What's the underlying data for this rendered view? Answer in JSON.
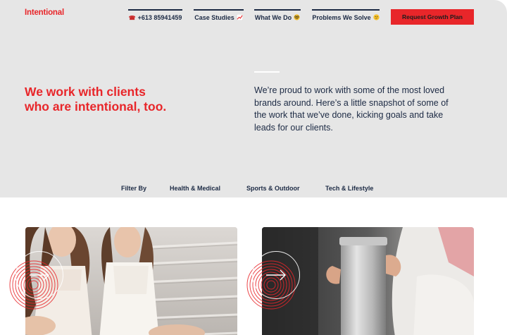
{
  "header": {
    "logo": "Intentional",
    "nav": {
      "phone": "+613 85941459",
      "case_studies": "Case Studies",
      "what_we_do": "What We Do",
      "problems": "Problems We Solve"
    },
    "cta_label": "Request Growth Plan"
  },
  "hero": {
    "headline_line1": "We work with clients",
    "headline_line2": "who are intentional, too.",
    "intro": "We’re proud to work with some of the most loved brands around. Here’s a little snapshot of some of the work that we’ve done, kicking goals and take leads for our clients."
  },
  "filters": {
    "label": "Filter By",
    "items": [
      "Health & Medical",
      "Sports & Outdoor",
      "Tech & Lifestyle"
    ]
  },
  "icons": {
    "phone": "telephone-icon",
    "case_studies": "chart-increasing-icon",
    "what_we_do": "nerd-face-icon",
    "problems": "thinking-face-icon",
    "arrow": "arrow-right-icon"
  },
  "colors": {
    "brand_red": "#e8262a",
    "navy": "#1c2a44",
    "hero_bg": "#e6e6e6"
  }
}
